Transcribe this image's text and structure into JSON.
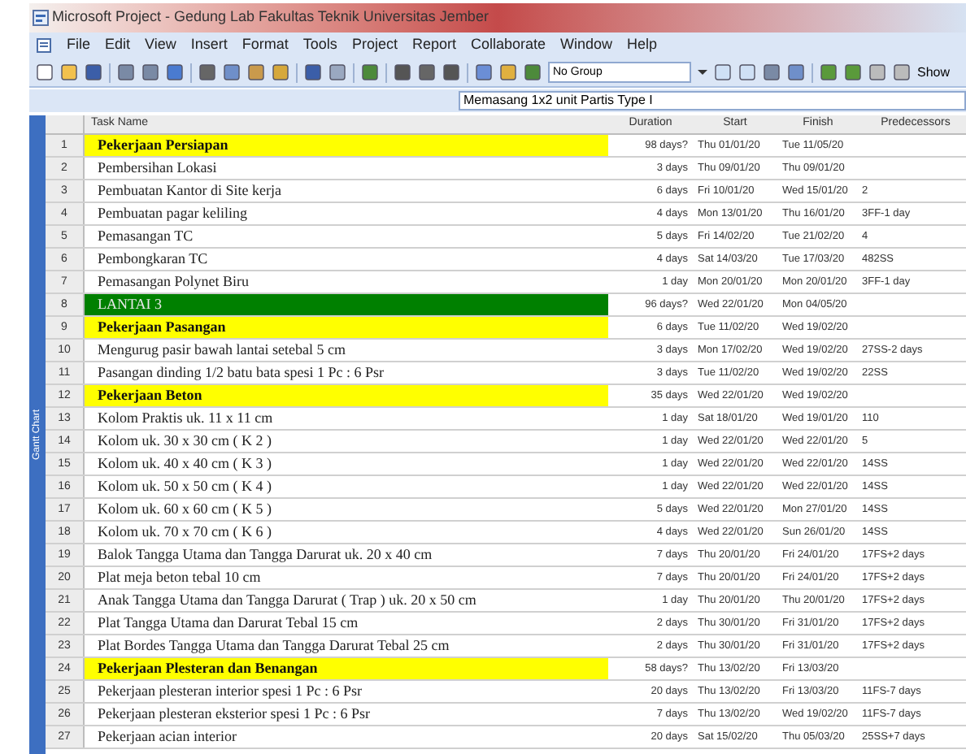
{
  "window": {
    "title": "Microsoft Project - Gedung Lab Fakultas Teknik Universitas Jember"
  },
  "menu": [
    "File",
    "Edit",
    "View",
    "Insert",
    "Format",
    "Tools",
    "Project",
    "Report",
    "Collaborate",
    "Window",
    "Help"
  ],
  "toolbar": {
    "group_dropdown": "No Group",
    "show_button": "Show"
  },
  "entry_bar": {
    "value": "Memasang 1x2 unit Partis Type I"
  },
  "side_label": "Gantt Chart",
  "table": {
    "columns": [
      "Task Name",
      "Duration",
      "Start",
      "Finish",
      "Predecessors"
    ],
    "rows": [
      {
        "id": "1",
        "kind": "summary",
        "name": "Pekerjaan Persiapan",
        "duration": "98 days?",
        "start": "Thu 01/01/20",
        "finish": "Tue 11/05/20",
        "predecessors": ""
      },
      {
        "id": "2",
        "kind": "task",
        "name": "Pembersihan Lokasi",
        "duration": "3 days",
        "start": "Thu 09/01/20",
        "finish": "Thu 09/01/20",
        "predecessors": ""
      },
      {
        "id": "3",
        "kind": "task",
        "name": "Pembuatan Kantor di Site kerja",
        "duration": "6 days",
        "start": "Fri 10/01/20",
        "finish": "Wed 15/01/20",
        "predecessors": "2"
      },
      {
        "id": "4",
        "kind": "task",
        "name": "Pembuatan pagar keliling",
        "duration": "4 days",
        "start": "Mon 13/01/20",
        "finish": "Thu 16/01/20",
        "predecessors": "3FF-1 day"
      },
      {
        "id": "5",
        "kind": "task",
        "name": "Pemasangan TC",
        "duration": "5 days",
        "start": "Fri 14/02/20",
        "finish": "Tue 21/02/20",
        "predecessors": "4"
      },
      {
        "id": "6",
        "kind": "task",
        "name": "Pembongkaran TC",
        "duration": "4 days",
        "start": "Sat 14/03/20",
        "finish": "Tue 17/03/20",
        "predecessors": "482SS"
      },
      {
        "id": "7",
        "kind": "task",
        "name": "Pemasangan Polynet Biru",
        "duration": "1 day",
        "start": "Mon 20/01/20",
        "finish": "Mon 20/01/20",
        "predecessors": "3FF-1 day"
      },
      {
        "id": "8",
        "kind": "phase",
        "name": "LANTAI 3",
        "duration": "96 days?",
        "start": "Wed 22/01/20",
        "finish": "Mon 04/05/20",
        "predecessors": ""
      },
      {
        "id": "9",
        "kind": "summary",
        "name": "Pekerjaan Pasangan",
        "duration": "6 days",
        "start": "Tue 11/02/20",
        "finish": "Wed 19/02/20",
        "predecessors": ""
      },
      {
        "id": "10",
        "kind": "task",
        "name": "Mengurug pasir bawah lantai setebal 5 cm",
        "duration": "3 days",
        "start": "Mon 17/02/20",
        "finish": "Wed 19/02/20",
        "predecessors": "27SS-2 days"
      },
      {
        "id": "11",
        "kind": "task",
        "name": "Pasangan dinding 1/2 batu bata spesi 1 Pc : 6 Psr",
        "duration": "3 days",
        "start": "Tue 11/02/20",
        "finish": "Wed 19/02/20",
        "predecessors": "22SS"
      },
      {
        "id": "12",
        "kind": "summary",
        "name": "Pekerjaan Beton",
        "duration": "35 days",
        "start": "Wed 22/01/20",
        "finish": "Wed 19/02/20",
        "predecessors": ""
      },
      {
        "id": "13",
        "kind": "task",
        "name": "Kolom Praktis uk. 11 x 11 cm",
        "duration": "1 day",
        "start": "Sat 18/01/20",
        "finish": "Wed 19/01/20",
        "predecessors": "110"
      },
      {
        "id": "14",
        "kind": "task",
        "name": "Kolom uk. 30 x 30 cm ( K 2 )",
        "duration": "1 day",
        "start": "Wed 22/01/20",
        "finish": "Wed 22/01/20",
        "predecessors": "5"
      },
      {
        "id": "15",
        "kind": "task",
        "name": "Kolom uk. 40 x 40 cm ( K 3 )",
        "duration": "1 day",
        "start": "Wed 22/01/20",
        "finish": "Wed 22/01/20",
        "predecessors": "14SS"
      },
      {
        "id": "16",
        "kind": "task",
        "name": "Kolom uk. 50 x 50 cm ( K 4 )",
        "duration": "1 day",
        "start": "Wed 22/01/20",
        "finish": "Wed 22/01/20",
        "predecessors": "14SS"
      },
      {
        "id": "17",
        "kind": "task",
        "name": "Kolom uk. 60 x 60 cm ( K 5 )",
        "duration": "5 days",
        "start": "Wed 22/01/20",
        "finish": "Mon 27/01/20",
        "predecessors": "14SS"
      },
      {
        "id": "18",
        "kind": "task",
        "name": "Kolom uk. 70 x 70 cm ( K 6 )",
        "duration": "4 days",
        "start": "Wed 22/01/20",
        "finish": "Sun 26/01/20",
        "predecessors": "14SS"
      },
      {
        "id": "19",
        "kind": "task",
        "name": "Balok Tangga Utama dan Tangga Darurat uk. 20 x 40 cm",
        "duration": "7 days",
        "start": "Thu 20/01/20",
        "finish": "Fri 24/01/20",
        "predecessors": "17FS+2 days"
      },
      {
        "id": "20",
        "kind": "task",
        "name": "Plat meja beton tebal 10 cm",
        "duration": "7 days",
        "start": "Thu 20/01/20",
        "finish": "Fri 24/01/20",
        "predecessors": "17FS+2 days"
      },
      {
        "id": "21",
        "kind": "task",
        "name": "Anak Tangga Utama dan Tangga Darurat ( Trap ) uk. 20 x 50 cm",
        "duration": "1 day",
        "start": "Thu 20/01/20",
        "finish": "Thu 20/01/20",
        "predecessors": "17FS+2 days"
      },
      {
        "id": "22",
        "kind": "task",
        "name": "Plat Tangga Utama dan Darurat Tebal 15 cm",
        "duration": "2 days",
        "start": "Thu 30/01/20",
        "finish": "Fri 31/01/20",
        "predecessors": "17FS+2 days"
      },
      {
        "id": "23",
        "kind": "task",
        "name": "Plat Bordes Tangga Utama dan Tangga Darurat Tebal 25 cm",
        "duration": "2 days",
        "start": "Thu 30/01/20",
        "finish": "Fri 31/01/20",
        "predecessors": "17FS+2 days"
      },
      {
        "id": "24",
        "kind": "summary",
        "name": "Pekerjaan Plesteran dan Benangan",
        "duration": "58 days?",
        "start": "Thu 13/02/20",
        "finish": "Fri 13/03/20",
        "predecessors": ""
      },
      {
        "id": "25",
        "kind": "task",
        "name": "Pekerjaan plesteran interior spesi 1 Pc : 6 Psr",
        "duration": "20 days",
        "start": "Thu 13/02/20",
        "finish": "Fri 13/03/20",
        "predecessors": "11FS-7 days"
      },
      {
        "id": "26",
        "kind": "task",
        "name": "Pekerjaan plesteran eksterior spesi 1 Pc : 6 Psr",
        "duration": "7 days",
        "start": "Thu 13/02/20",
        "finish": "Wed 19/02/20",
        "predecessors": "11FS-7 days"
      },
      {
        "id": "27",
        "kind": "task",
        "name": "Pekerjaan acian interior",
        "duration": "20 days",
        "start": "Sat 15/02/20",
        "finish": "Thu 05/03/20",
        "predecessors": "25SS+7 days"
      }
    ]
  }
}
